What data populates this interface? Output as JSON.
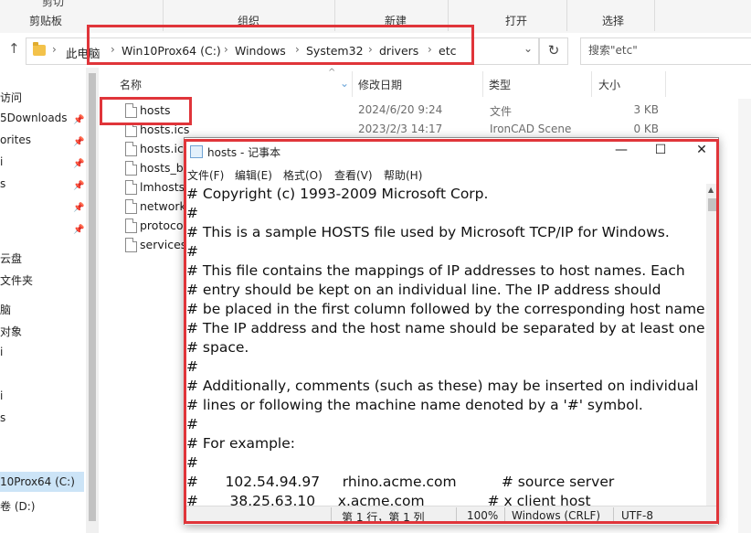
{
  "ribbon": {
    "clipboard_cut": "剪切",
    "groups": [
      "剪贴板",
      "组织",
      "新建",
      "打开",
      "选择"
    ]
  },
  "address": {
    "crumbs": [
      "此电脑",
      "Win10Prox64 (C:)",
      "Windows",
      "System32",
      "drivers",
      "etc"
    ],
    "search_placeholder": "搜索\"etc\""
  },
  "nav": {
    "items": [
      "访问",
      "5Downloads",
      "orites",
      "i",
      "s",
      "",
      "云盘",
      "文件夹",
      "脑",
      "对象",
      "i",
      "",
      "i",
      "s",
      "",
      "10Prox64 (C:)",
      "卷 (D:)"
    ]
  },
  "columns": {
    "name": "名称",
    "modified": "修改日期",
    "type": "类型",
    "size": "大小"
  },
  "files": [
    {
      "name": "hosts",
      "modified": "2024/6/20 9:24",
      "type": "文件",
      "size": "3 KB"
    },
    {
      "name": "hosts.ics",
      "modified": "2023/2/3 14:17",
      "type": "IronCAD Scene",
      "size": "0 KB"
    },
    {
      "name": "hosts.ics",
      "modified": "",
      "type": "",
      "size": ""
    },
    {
      "name": "hosts_b",
      "modified": "",
      "type": "",
      "size": ""
    },
    {
      "name": "lmhosts",
      "modified": "",
      "type": "",
      "size": ""
    },
    {
      "name": "network",
      "modified": "",
      "type": "",
      "size": ""
    },
    {
      "name": "protoco",
      "modified": "",
      "type": "",
      "size": ""
    },
    {
      "name": "services",
      "modified": "",
      "type": "",
      "size": ""
    }
  ],
  "notepad": {
    "title": "hosts - 记事本",
    "min": "—",
    "max": "☐",
    "close": "✕",
    "menu": [
      "文件(F)",
      "编辑(E)",
      "格式(O)",
      "查看(V)",
      "帮助(H)"
    ],
    "lines": [
      "# Copyright (c) 1993-2009 Microsoft Corp.",
      "#",
      "# This is a sample HOSTS file used by Microsoft TCP/IP for Windows.",
      "#",
      "# This file contains the mappings of IP addresses to host names. Each",
      "# entry should be kept on an individual line. The IP address should",
      "# be placed in the first column followed by the corresponding host name.",
      "# The IP address and the host name should be separated by at least one",
      "# space.",
      "#",
      "# Additionally, comments (such as these) may be inserted on individual",
      "# lines or following the machine name denoted by a '#' symbol.",
      "#",
      "# For example:",
      "#",
      "#      102.54.94.97     rhino.acme.com          # source server",
      "#       38.25.63.10     x.acme.com              # x client host"
    ],
    "status": {
      "position": "第 1 行，第 1 列",
      "zoom": "100%",
      "line_ending": "Windows (CRLF)",
      "encoding": "UTF-8"
    }
  },
  "colors": {
    "highlight": "#e0353a",
    "selection": "#cce4f7"
  }
}
